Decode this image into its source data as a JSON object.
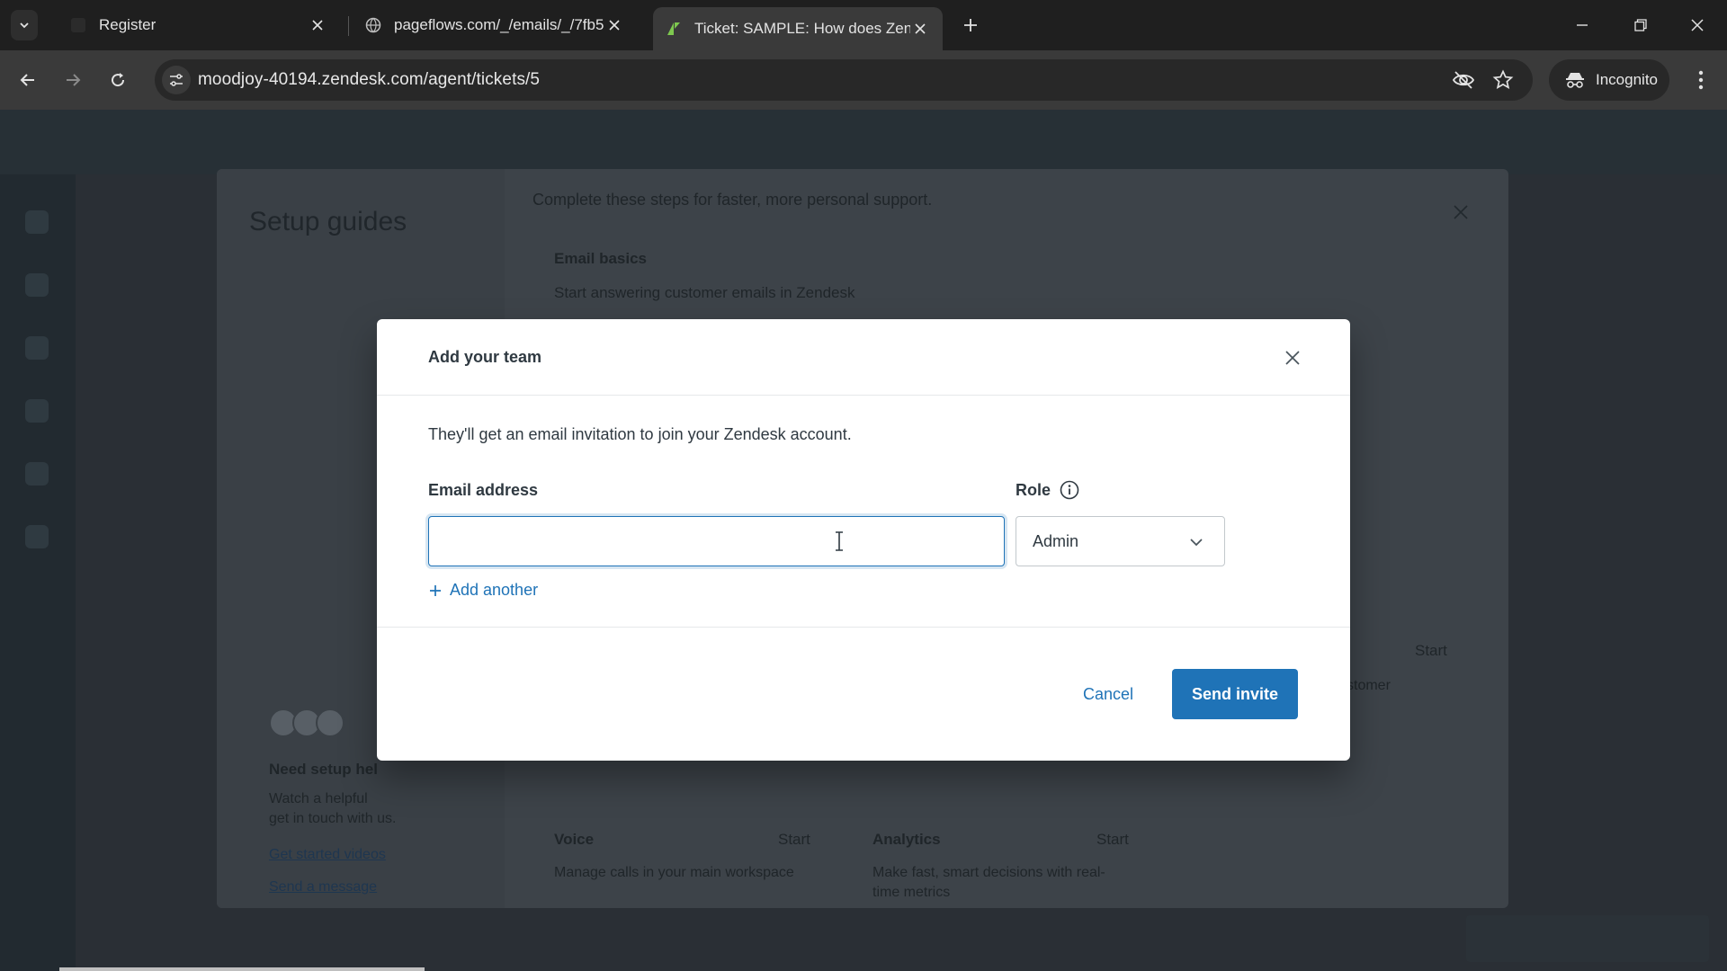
{
  "browser": {
    "tabs": [
      {
        "title": "Register",
        "active": false
      },
      {
        "title": "pageflows.com/_/emails/_/7fb5",
        "active": false
      },
      {
        "title": "Ticket: SAMPLE: How does Zen",
        "active": true
      }
    ],
    "url": "moodjoy-40194.zendesk.com/agent/tickets/5",
    "incognito_label": "Incognito"
  },
  "background_page": {
    "setup_title": "Setup guides",
    "subtitle": "Complete these steps for faster, more personal support.",
    "section_title": "Email basics",
    "section_desc": "Start answering customer emails in Zendesk",
    "help_title": "Need setup hel",
    "help_desc_1": "Watch a helpful",
    "help_desc_2": "get in touch with us.",
    "link_videos": "Get started videos",
    "link_message": "Send a message",
    "voice_title": "Voice",
    "voice_start": "Start",
    "voice_desc": "Manage calls in your main workspace",
    "analytics_title": "Analytics",
    "analytics_start": "Start",
    "analytics_desc_1": "Make fast, smart decisions with real-",
    "analytics_desc_2": "time metrics",
    "right_start": "Start",
    "right_partial": "stomer"
  },
  "modal": {
    "title": "Add your team",
    "description": "They'll get an email invitation to join your Zendesk account.",
    "email_label": "Email address",
    "email_value": "",
    "role_label": "Role",
    "role_value": "Admin",
    "add_another": "Add another",
    "cancel": "Cancel",
    "send": "Send invite"
  },
  "colors": {
    "primary": "#1f73b7",
    "text": "#2f3941",
    "chrome_bg": "#1f1f1f",
    "toolbar_bg": "#3a3a3a"
  }
}
